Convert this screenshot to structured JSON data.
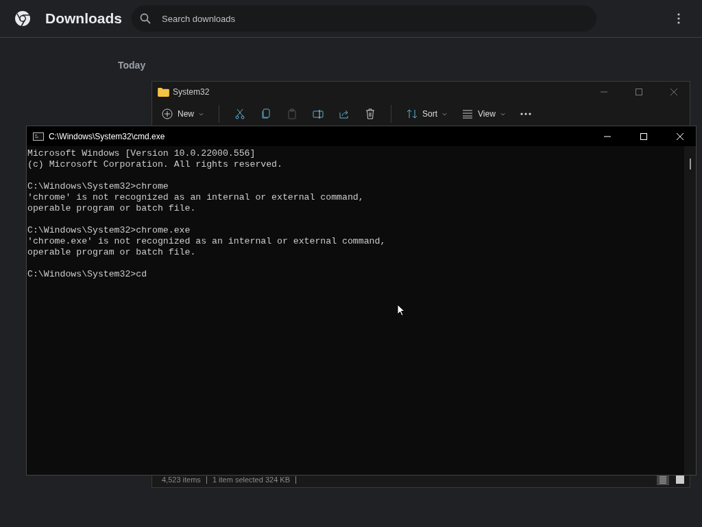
{
  "header": {
    "title": "Downloads",
    "search": {
      "placeholder": "Search downloads"
    }
  },
  "section": {
    "heading": "Today"
  },
  "explorer": {
    "title": "System32",
    "toolbar": {
      "new": "New",
      "sort": "Sort",
      "view": "View"
    },
    "status": [
      "4,523 items",
      "1 item selected  324 KB"
    ]
  },
  "cmd": {
    "title": "C:\\Windows\\System32\\cmd.exe",
    "blocks": [
      [
        "Microsoft Windows [Version 10.0.22000.556]",
        "(c) Microsoft Corporation. All rights reserved."
      ],
      [
        "C:\\Windows\\System32>chrome",
        "'chrome' is not recognized as an internal or external command,",
        "operable program or batch file."
      ],
      [
        "C:\\Windows\\System32>chrome.exe",
        "'chrome.exe' is not recognized as an internal or external command,",
        "operable program or batch file."
      ],
      [
        "C:\\Windows\\System32>cd"
      ]
    ]
  }
}
